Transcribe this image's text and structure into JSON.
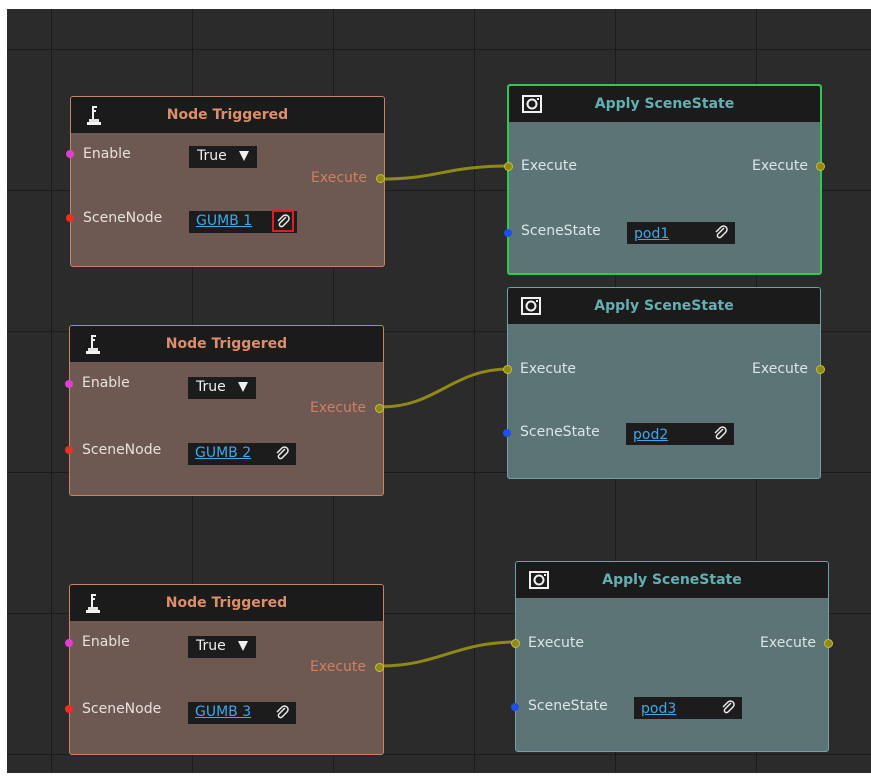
{
  "trigger_nodes": [
    {
      "title": "Node Triggered",
      "enable_label": "Enable",
      "enable_value": "True",
      "scene_label": "SceneNode",
      "scene_value": "GUMB 1",
      "execute_label": "Execute"
    },
    {
      "title": "Node Triggered",
      "enable_label": "Enable",
      "enable_value": "True",
      "scene_label": "SceneNode",
      "scene_value": "GUMB 2",
      "execute_label": "Execute"
    },
    {
      "title": "Node Triggered",
      "enable_label": "Enable",
      "enable_value": "True",
      "scene_label": "SceneNode",
      "scene_value": "GUMB 3",
      "execute_label": "Execute"
    }
  ],
  "apply_nodes": [
    {
      "title": "Apply SceneState",
      "execute_in_label": "Execute",
      "execute_out_label": "Execute",
      "state_label": "SceneState",
      "state_value": "pod1"
    },
    {
      "title": "Apply SceneState",
      "execute_in_label": "Execute",
      "execute_out_label": "Execute",
      "state_label": "SceneState",
      "state_value": "pod2"
    },
    {
      "title": "Apply SceneState",
      "execute_in_label": "Execute",
      "execute_out_label": "Execute",
      "state_label": "SceneState",
      "state_value": "pod3"
    }
  ],
  "colors": {
    "trigger_accent": "#db8f6a",
    "apply_accent": "#63b0b3",
    "selected_border": "#2fc94b",
    "link_text": "#3fa8ea",
    "wire": "#8f8a16",
    "highlight_outline": "#e11d1d"
  },
  "icons": {
    "trigger": "joystick-icon",
    "apply": "camera-icon",
    "dropdown": "chevron-down-icon",
    "pick": "paperclip-icon"
  }
}
